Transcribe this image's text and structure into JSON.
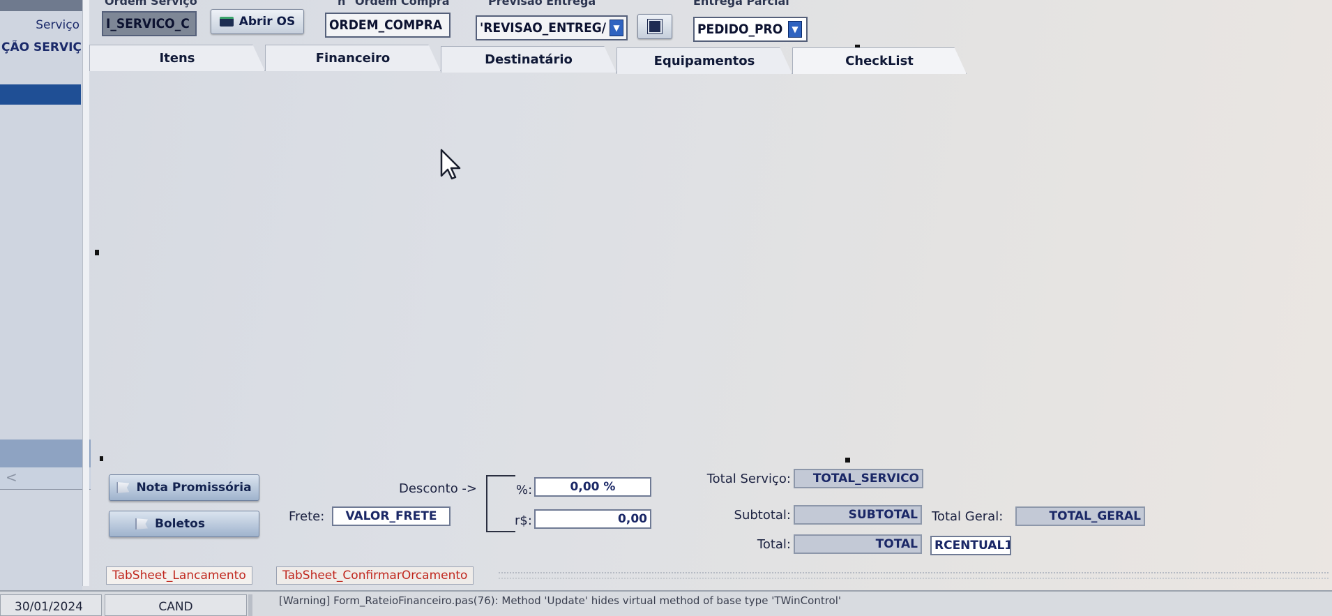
{
  "left_panel": {
    "label_servico": "Serviço",
    "label_situacao": "ÇÃO SERVIÇ"
  },
  "top_fields": {
    "ordem_servico": {
      "label": "Ordem Serviço",
      "value": "I_SERVICO_C"
    },
    "abrir_os_label": "Abrir OS",
    "ordem_compra": {
      "label": "n° Ordem Compra",
      "value": "ORDEM_COMPRA"
    },
    "previsao_entrega": {
      "label": "Previsão Entrega",
      "value": "'REVISAO_ENTREG/"
    },
    "entrega_parcial": {
      "label": "Entrega Parcial",
      "value": "PEDIDO_PRO"
    }
  },
  "tabs": [
    {
      "label": "Itens"
    },
    {
      "label": "Financeiro"
    },
    {
      "label": "Destinatário"
    },
    {
      "label": "Equipamentos"
    },
    {
      "label": "CheckList"
    }
  ],
  "buttons": {
    "nota_promissoria": "Nota Promissória",
    "boletos": "Boletos"
  },
  "frete": {
    "label": "Frete:",
    "value": "VALOR_FRETE"
  },
  "desconto": {
    "label": "Desconto ->",
    "pct_label": "%:",
    "pct_value": "0,00 %",
    "rs_label": "r$:",
    "rs_value": "0,00"
  },
  "totals": {
    "total_servico_label": "Total Serviço:",
    "total_servico_value": "TOTAL_SERVICO",
    "subtotal_label": "Subtotal:",
    "subtotal_value": "SUBTOTAL",
    "total_geral_label": "Total Geral:",
    "total_geral_value": "TOTAL_GERAL",
    "total_label": "Total:",
    "total_value": "TOTAL",
    "percentual_value": "RCENTUAL1"
  },
  "sheet_tabs": [
    {
      "label": "TabSheet_Lancamento"
    },
    {
      "label": "TabSheet_ConfirmarOrcamento"
    }
  ],
  "status_bar": {
    "date": "30/01/2024",
    "status": "CAND",
    "warning": "[Warning] Form_RateioFinanceiro.pas(76): Method 'Update' hides virtual method of base type 'TWinControl'"
  },
  "icons": {
    "abrir_os": "folder-icon",
    "previsao_edit": "edit-icon",
    "dropdown": "chevron-down-icon",
    "cursor": "mouse-pointer-icon"
  },
  "colors": {
    "selection_blue": "#1f4f95",
    "sheet_tab_text": "#c0261d",
    "dropdown_blue": "#2f63c0"
  }
}
